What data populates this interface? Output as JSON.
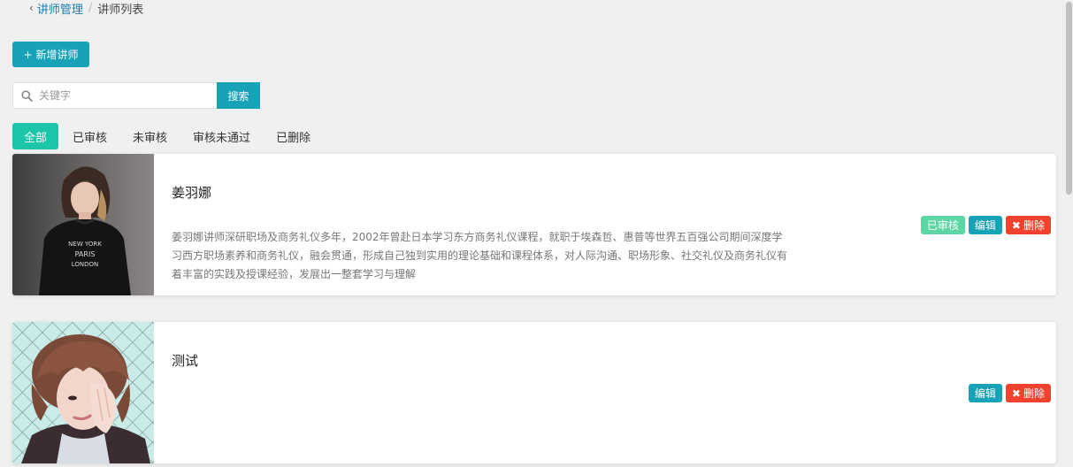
{
  "breadcrumb": {
    "parent": "讲师管理",
    "separator": "/",
    "current": "讲师列表"
  },
  "toolbar": {
    "add_label": "新增讲师"
  },
  "search": {
    "placeholder": "关键字",
    "value": "",
    "button_label": "搜索"
  },
  "tabs": [
    {
      "label": "全部",
      "active": true
    },
    {
      "label": "已审核",
      "active": false
    },
    {
      "label": "未审核",
      "active": false
    },
    {
      "label": "审核未通过",
      "active": false
    },
    {
      "label": "已删除",
      "active": false
    }
  ],
  "lecturers": [
    {
      "name": "姜羽娜",
      "description": "姜羽娜讲师深研职场及商务礼仪多年，2002年曾赴日本学习东方商务礼仪课程，就职于埃森哲、惠普等世界五百强公司期间深度学习西方职场素养和商务礼仪，融会贯通，形成自己独到实用的理论基础和课程体系，对人际沟通、职场形象、社交礼仪及商务礼仪有着丰富的实践及授课经验，发展出一整套学习与理解",
      "status_label": "已审核",
      "edit_label": "编辑",
      "delete_label": "删除",
      "shirt_text": [
        "NEW YORK",
        "PARIS",
        "LONDON"
      ]
    },
    {
      "name": "测试",
      "description": "",
      "edit_label": "编辑",
      "delete_label": "删除"
    }
  ],
  "colors": {
    "primary": "#17a2b8",
    "tab_active": "#1dc5a8",
    "approved": "#5cd6a4",
    "danger": "#f0422d",
    "link": "#1a7fb0",
    "page_bg": "#f0f0f0"
  },
  "icons": {
    "back": "chevron-left-icon",
    "add": "plus-icon",
    "search": "search-icon",
    "delete": "close-x-icon"
  }
}
